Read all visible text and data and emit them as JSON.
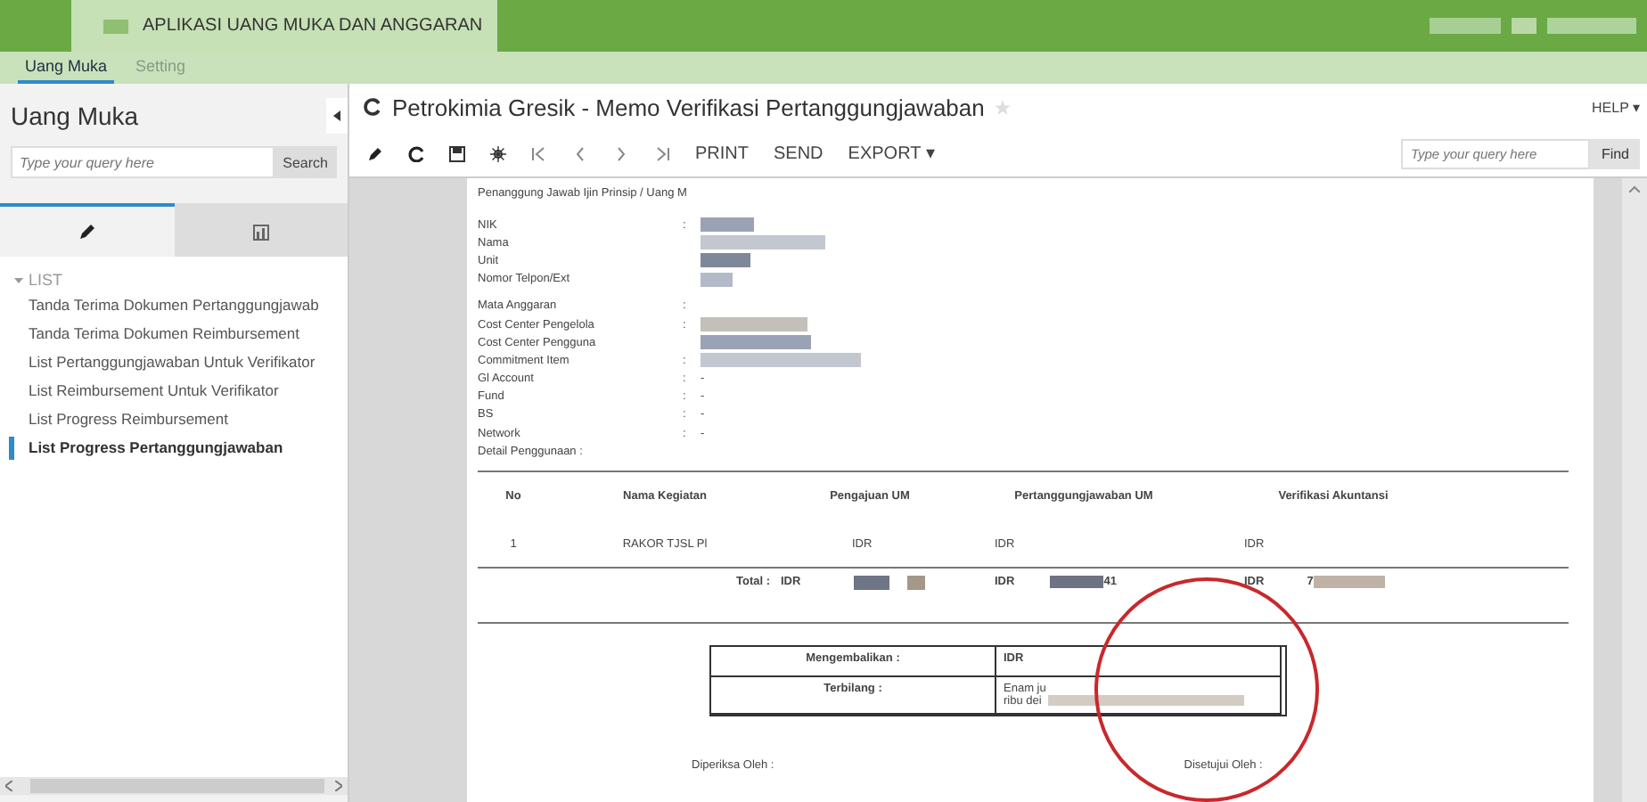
{
  "app_bar": {
    "title": "APLIKASI UANG MUKA DAN ANGGARAN"
  },
  "menu_tabs": [
    {
      "label": "Uang Muka",
      "selected": true
    },
    {
      "label": "Setting",
      "selected": false
    }
  ],
  "sidebar": {
    "title": "Uang Muka",
    "search": {
      "placeholder": "Type your query here",
      "button": "Search"
    },
    "tabs": [
      {
        "kind": "edit",
        "selected": true
      },
      {
        "kind": "chart",
        "selected": false
      }
    ],
    "tree": {
      "label": "LIST",
      "expanded": true,
      "children": [
        {
          "label": "Tanda Terima Dokumen Pertanggungjawab",
          "selected": false
        },
        {
          "label": "Tanda Terima Dokumen Reimbursement",
          "selected": false
        },
        {
          "label": "List Pertanggungjawaban Untuk Verifikator",
          "selected": false
        },
        {
          "label": "List Reimbursement Untuk Verifikator",
          "selected": false
        },
        {
          "label": "List Progress Reimbursement",
          "selected": false
        },
        {
          "label": "List Progress Pertanggungjawaban",
          "selected": true
        }
      ]
    }
  },
  "report_header": {
    "title": "Petrokimia Gresik - Memo Verifikasi Pertanggungjawaban",
    "favorite": false,
    "help": "HELP ▾"
  },
  "toolbar": {
    "buttons": [
      "PRINT",
      "SEND",
      "EXPORT ▾"
    ],
    "search": {
      "placeholder": "Type your query here",
      "button": "Find"
    }
  },
  "document": {
    "heading": "Penanggung Jawab Ijin Prinsip / Uang M",
    "fields": [
      {
        "label": "NIK",
        "separator": ":",
        "redacted": true
      },
      {
        "label": "Nama",
        "redacted": true
      },
      {
        "label": "Unit",
        "redacted": true
      },
      {
        "label": "Nomor Telpon/Ext",
        "redacted": true
      },
      {
        "label": "Mata Anggaran",
        "separator": ":",
        "gap": true
      },
      {
        "label": "Cost Center Pengelola",
        "separator": ":",
        "redacted": true
      },
      {
        "label": "Cost Center Pengguna",
        "redacted": true
      },
      {
        "label": "Commitment Item",
        "separator": ":",
        "redacted": true
      },
      {
        "label": "Gl Account",
        "separator": ":",
        "value": "-"
      },
      {
        "label": "Fund",
        "separator": ":",
        "value": "-"
      },
      {
        "label": "BS",
        "separator": ":",
        "value": "-"
      },
      {
        "label": "Network",
        "separator": ":",
        "value": "-"
      },
      {
        "label": "Detail Penggunaan :"
      }
    ],
    "table": {
      "columns": [
        "No",
        "Nama Kegiatan",
        "Pengajuan UM",
        "Pertanggungjawaban UM",
        "Verifikasi Akuntansi"
      ],
      "rows": [
        {
          "no": "1",
          "name": "RAKOR TJSL Pl",
          "pengajuan": "IDR",
          "pertanggungjawaban": "IDR",
          "verifikasi": "IDR"
        }
      ],
      "total": {
        "label": "Total :",
        "pengajuan": "IDR",
        "pertanggungjawaban": "IDR",
        "pertanggungjawaban_tail": "41",
        "verifikasi": "IDR",
        "verifikasi_head": "7"
      }
    },
    "summary": {
      "return_label": "Mengembalikan :",
      "return_value": "IDR",
      "words_label": "Terbilang :",
      "words_line_1": "Enam ju",
      "words_line_2": "ribu dei"
    },
    "signatures": [
      "Diperiksa Oleh :",
      "Disetujui Oleh :"
    ]
  }
}
